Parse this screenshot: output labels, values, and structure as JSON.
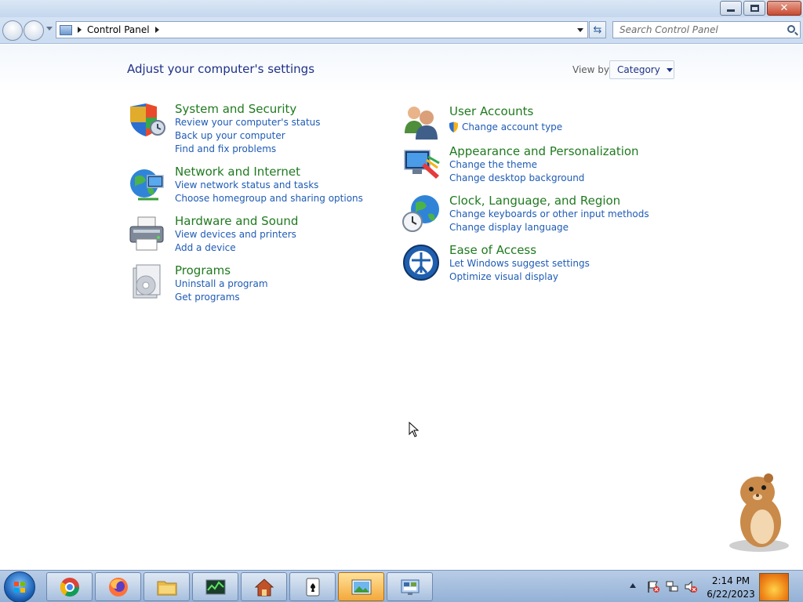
{
  "window": {
    "breadcrumb": [
      "Control Panel"
    ],
    "search_placeholder": "Search Control Panel"
  },
  "main": {
    "title": "Adjust your computer's settings",
    "view_by_label": "View by:",
    "view_by_value": "Category"
  },
  "categories": {
    "system_security": {
      "title": "System and Security",
      "links": [
        "Review your computer's status",
        "Back up your computer",
        "Find and fix problems"
      ]
    },
    "network_internet": {
      "title": "Network and Internet",
      "links": [
        "View network status and tasks",
        "Choose homegroup and sharing options"
      ]
    },
    "hardware_sound": {
      "title": "Hardware and Sound",
      "links": [
        "View devices and printers",
        "Add a device"
      ]
    },
    "programs": {
      "title": "Programs",
      "links": [
        "Uninstall a program",
        "Get programs"
      ]
    },
    "user_accounts": {
      "title": "User Accounts",
      "links": [
        "Change account type"
      ]
    },
    "appearance": {
      "title": "Appearance and Personalization",
      "links": [
        "Change the theme",
        "Change desktop background"
      ]
    },
    "clock_language": {
      "title": "Clock, Language, and Region",
      "links": [
        "Change keyboards or other input methods",
        "Change display language"
      ]
    },
    "ease_of_access": {
      "title": "Ease of Access",
      "links": [
        "Let Windows suggest settings",
        "Optimize visual display"
      ]
    }
  },
  "taskbar": {
    "pinned": [
      "chrome-icon",
      "firefox-icon",
      "file-explorer-icon",
      "task-manager-icon",
      "home-app-icon",
      "solitaire-icon",
      "photo-viewer-icon",
      "control-panel-icon"
    ],
    "active": "photo-viewer-icon",
    "time": "2:14 PM",
    "date": "6/22/2023"
  },
  "colors": {
    "category_title": "#1f7a1f",
    "link": "#1e5bb5",
    "heading": "#1e3287"
  }
}
